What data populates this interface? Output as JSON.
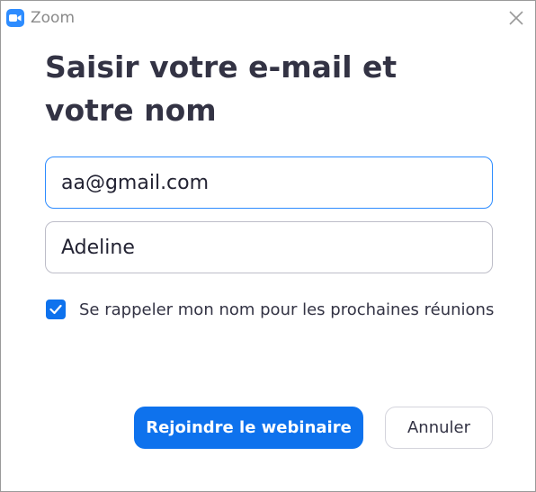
{
  "window": {
    "title": "Zoom",
    "icon": "zoom-camera-icon",
    "close_icon": "close-icon"
  },
  "dialog": {
    "heading": "Saisir votre e-mail et votre nom",
    "email_value": "aa@gmail.com",
    "name_value": "Adeline",
    "remember_checked": true,
    "remember_label": "Se rappeler mon nom pour les prochaines réunions",
    "join_button": "Rejoindre le webinaire",
    "cancel_button": "Annuler"
  },
  "colors": {
    "accent": "#0e72ed",
    "zoom_blue": "#2d8cff",
    "text": "#333344",
    "border": "#bdbdc8"
  }
}
